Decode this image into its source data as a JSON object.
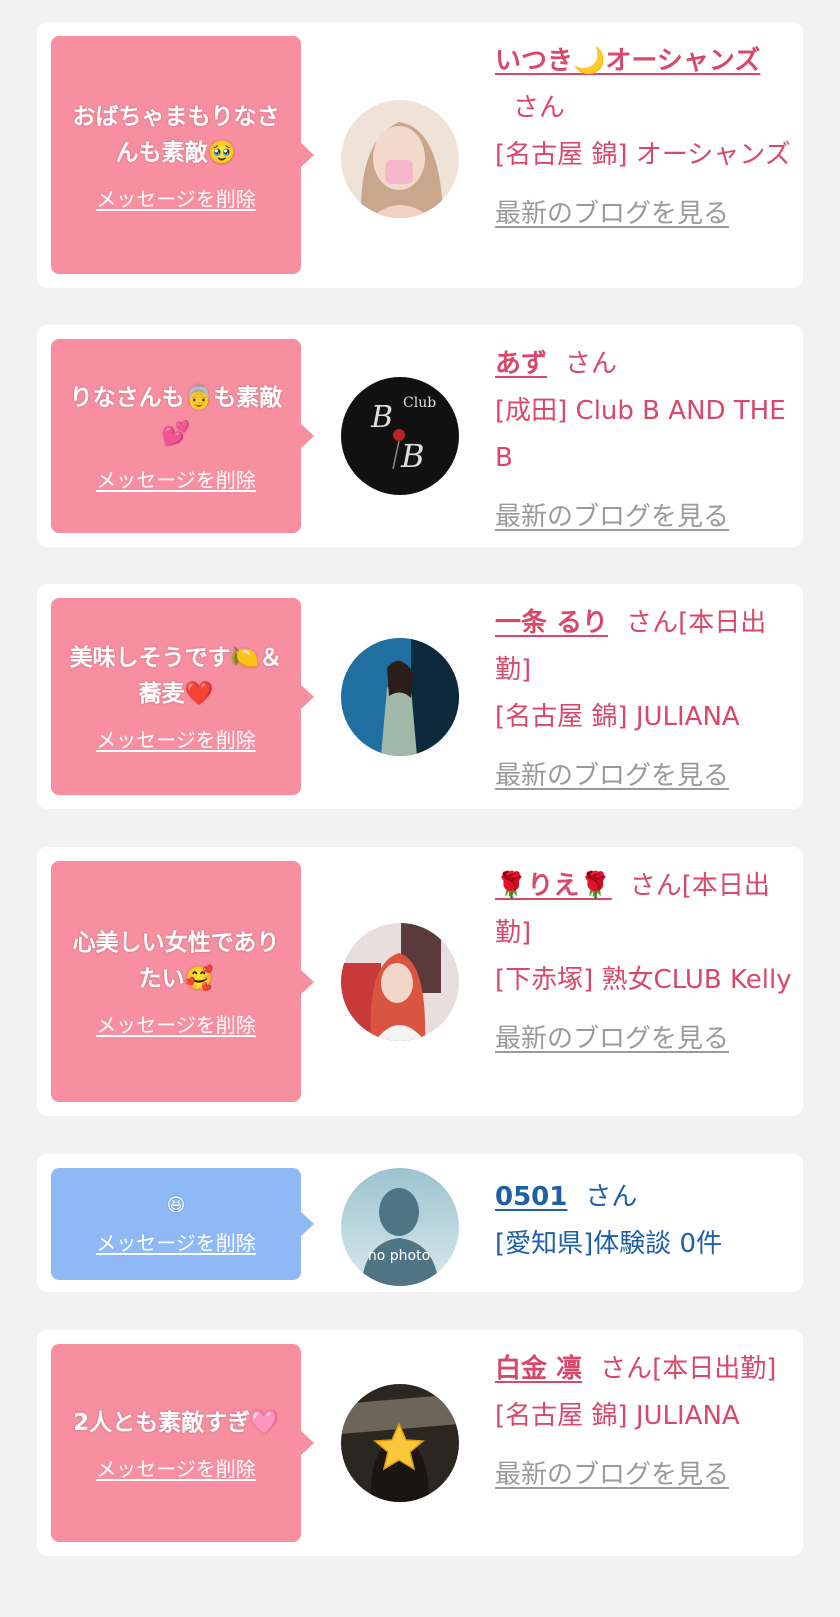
{
  "delete_label": "メッセージを削除",
  "blog_label": "最新のブログを見る",
  "san": "さん",
  "colors": {
    "pink_bubble": "#f78fa0",
    "blue_bubble": "#8eb9f5",
    "pink_text": "#d9486b",
    "blue_text": "#1e5fa6",
    "link_gray": "#9a9a9a"
  },
  "cards": [
    {
      "message": "おばちゃまもりなさんも素敵🥹",
      "name": "いつき🌙オーシャンズ",
      "suffix": "さん",
      "shop": "[名古屋 錦] オーシャンズ",
      "avatar": "woman-portrait-icon"
    },
    {
      "message": "りなさんも👵も素敵💕",
      "name": "あず",
      "suffix": "さん",
      "shop": "[成田] Club B AND THE B",
      "avatar": "club-b-logo-icon"
    },
    {
      "message": "美味しそうです🍋＆蕎麦❤️",
      "name": "一条 るり",
      "suffix": "さん[本日出勤]",
      "shop": "[名古屋 錦] JULIANA",
      "avatar": "woman-dress-icon"
    },
    {
      "message": "心美しい女性でありたい🥰",
      "name": "🌹りえ🌹",
      "suffix": "さん[本日出勤]",
      "shop": "[下赤塚] 熟女CLUB Kelly",
      "avatar": "woman-red-hair-icon"
    },
    {
      "message": "😆",
      "name": "0501",
      "suffix": "さん",
      "shop": "[愛知県]体験談 0件",
      "avatar": "no-photo-icon",
      "no_photo_text": "no photo"
    },
    {
      "message": "2人とも素敵すぎ🩷",
      "name": "白金 凛",
      "suffix": "さん[本日出勤]",
      "shop": "[名古屋 錦] JULIANA",
      "avatar": "star-face-icon"
    }
  ]
}
